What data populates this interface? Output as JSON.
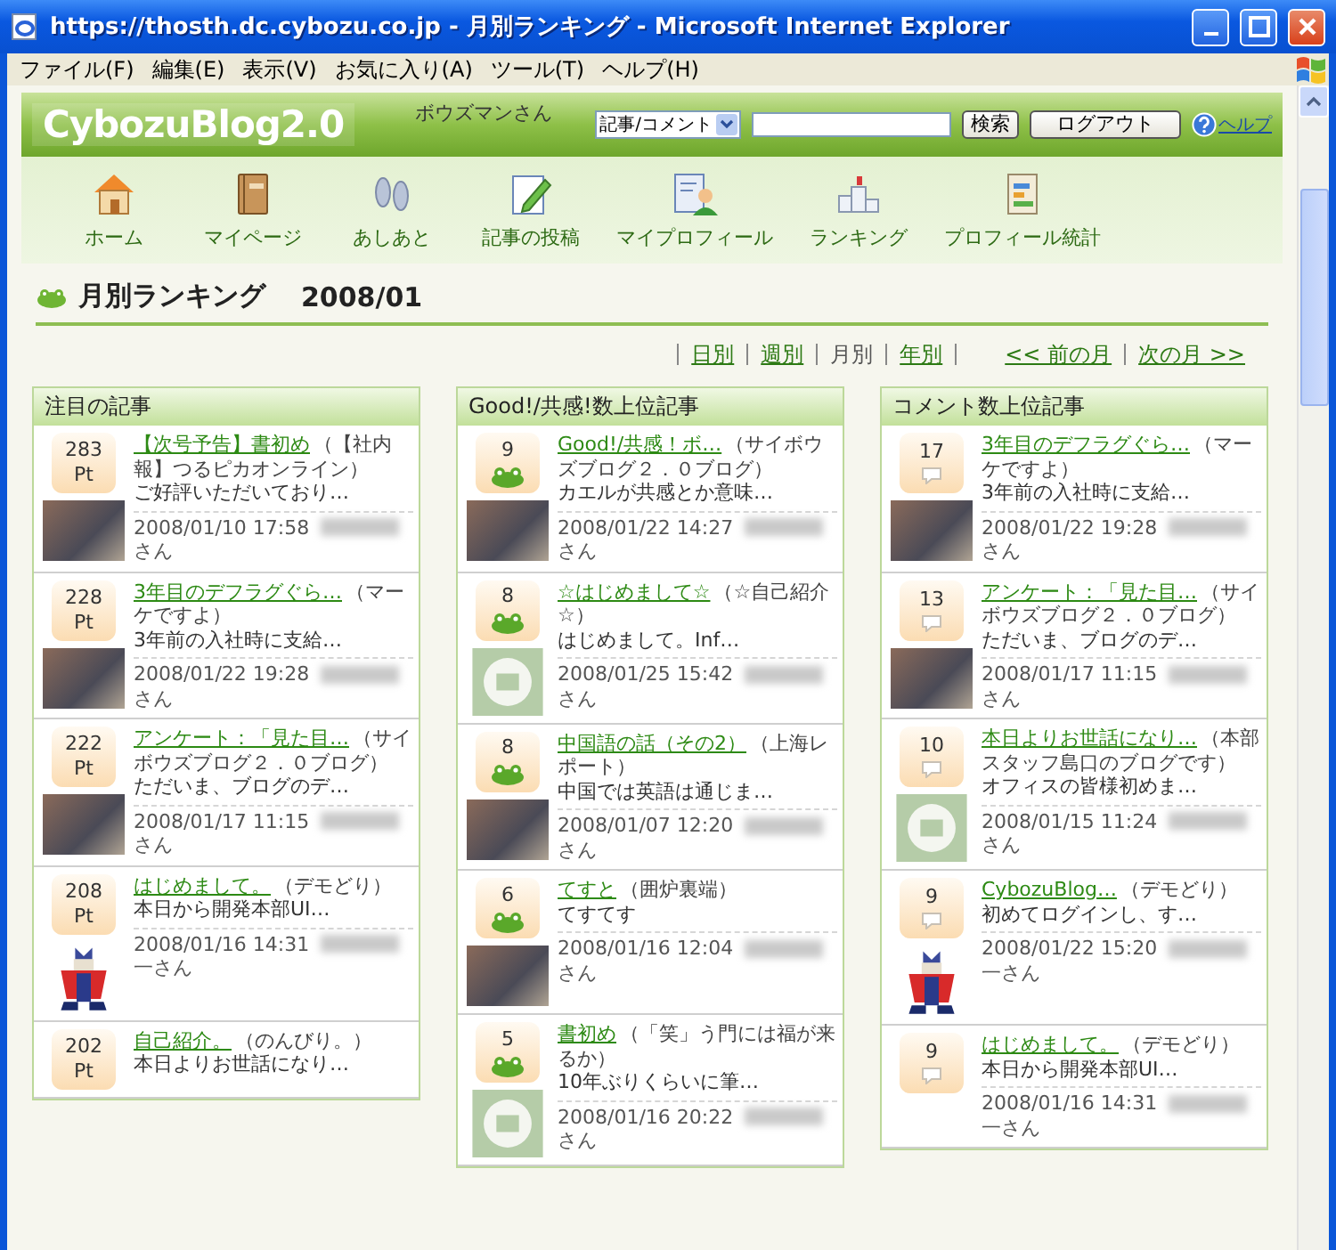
{
  "window": {
    "title": "https://thosth.dc.cybozu.co.jp - 月別ランキング - Microsoft Internet Explorer"
  },
  "menu": [
    "ファイル(F)",
    "編集(E)",
    "表示(V)",
    "お気に入り(A)",
    "ツール(T)",
    "ヘルプ(H)"
  ],
  "header": {
    "logo": "CybozuBlog2.0",
    "user": "ボウズマンさん",
    "scope": "記事/コメント",
    "search_button": "検索",
    "logout_button": "ログアウト",
    "help": "ヘルプ"
  },
  "nav": [
    {
      "label": "ホーム",
      "kind": "home"
    },
    {
      "label": "マイページ",
      "kind": "book"
    },
    {
      "label": "あしあと",
      "kind": "feet"
    },
    {
      "label": "記事の投稿",
      "kind": "post"
    },
    {
      "label": "マイプロフィール",
      "kind": "profile"
    },
    {
      "label": "ランキング",
      "kind": "podium"
    },
    {
      "label": "プロフィール統計",
      "kind": "stats"
    }
  ],
  "page_title": {
    "title": "月別ランキング",
    "period": "2008/01"
  },
  "period_links": [
    {
      "label": "日別",
      "selected": false
    },
    {
      "label": "週別",
      "selected": false
    },
    {
      "label": "月別",
      "selected": true
    },
    {
      "label": "年別",
      "selected": false
    }
  ],
  "month_links": [
    "<< 前の月",
    "次の月 >>"
  ],
  "columns": [
    {
      "title": "注目の記事",
      "kind": "points",
      "entries": [
        {
          "score": "283",
          "unit": "Pt",
          "title": "【次号予告】書初め",
          "source": "（【社内報】つるピカオンライン）",
          "excerpt": "ご好評いただいており…",
          "date": "2008/01/10 17:58",
          "author": "さん",
          "kind": "photo"
        },
        {
          "score": "228",
          "unit": "Pt",
          "title": "3年目のデフラグぐら…",
          "source": "（マーケですよ）",
          "excerpt": "3年前の入社時に支給…",
          "date": "2008/01/22 19:28",
          "author": "さん",
          "kind": "photo"
        },
        {
          "score": "222",
          "unit": "Pt",
          "title": "アンケート：「見た目…",
          "source": "（サイボウズブログ２．０ブログ）",
          "excerpt": "ただいま、ブログのデ…",
          "date": "2008/01/17 11:15",
          "author": "さん",
          "kind": "photo"
        },
        {
          "score": "208",
          "unit": "Pt",
          "title": "はじめまして。",
          "source": "（デモどり）",
          "excerpt": "本日から開発本部UI…",
          "date": "2008/01/16 14:31",
          "author": "一さん",
          "kind": "figure"
        },
        {
          "score": "202",
          "unit": "Pt",
          "title": "自己紹介。",
          "source": "（のんびり。）",
          "excerpt": "本日よりお世話になり…"
        }
      ]
    },
    {
      "title": "Good!/共感!数上位記事",
      "kind": "good",
      "entries": [
        {
          "score": "9",
          "title": "Good!/共感！ボ…",
          "source": "（サイボウズブログ２．０ブログ）",
          "excerpt": "カエルが共感とか意味…",
          "date": "2008/01/22 14:27",
          "author": "さん",
          "kind": "photo"
        },
        {
          "score": "8",
          "title": "☆はじめまして☆",
          "source": "（☆自己紹介☆）",
          "excerpt": "はじめまして。Inf…",
          "date": "2008/01/25 15:42",
          "author": "さん",
          "kind": "emblem"
        },
        {
          "score": "8",
          "title": "中国語の話（その2）",
          "source": "（上海レポート）",
          "excerpt": "中国では英語は通じま…",
          "date": "2008/01/07 12:20",
          "author": "さん",
          "kind": "photo"
        },
        {
          "score": "6",
          "title": "てすと",
          "source": "（囲炉裏端）",
          "excerpt": "てすてす",
          "date": "2008/01/16 12:04",
          "author": "さん",
          "kind": "photo"
        },
        {
          "score": "5",
          "title": "書初め",
          "source": "（「笑」う門には福が来るか）",
          "excerpt": "10年ぶりくらいに筆…",
          "date": "2008/01/16 20:22",
          "author": "さん",
          "kind": "emblem"
        }
      ]
    },
    {
      "title": "コメント数上位記事",
      "kind": "comment",
      "entries": [
        {
          "score": "17",
          "title": "3年目のデフラグぐら…",
          "source": "（マーケですよ）",
          "excerpt": "3年前の入社時に支給…",
          "date": "2008/01/22 19:28",
          "author": "さん",
          "kind": "photo"
        },
        {
          "score": "13",
          "title": "アンケート：「見た目…",
          "source": "（サイボウズブログ２．０ブログ）",
          "excerpt": "ただいま、ブログのデ…",
          "date": "2008/01/17 11:15",
          "author": "さん",
          "kind": "photo"
        },
        {
          "score": "10",
          "title": "本日よりお世話になり…",
          "source": "（本部スタッフ島口のブログです）",
          "excerpt": "オフィスの皆様初めま…",
          "date": "2008/01/15 11:24",
          "author": "さん",
          "kind": "emblem"
        },
        {
          "score": "9",
          "title": "CybozuBlog…",
          "source": "（デモどり）",
          "excerpt": "初めてログインし、す…",
          "date": "2008/01/22 15:20",
          "author": "一さん",
          "kind": "figure"
        },
        {
          "score": "9",
          "title": "はじめまして。",
          "source": "（デモどり）",
          "excerpt": "本日から開発本部UI…",
          "date": "2008/01/16 14:31",
          "author": "一さん"
        }
      ]
    }
  ]
}
